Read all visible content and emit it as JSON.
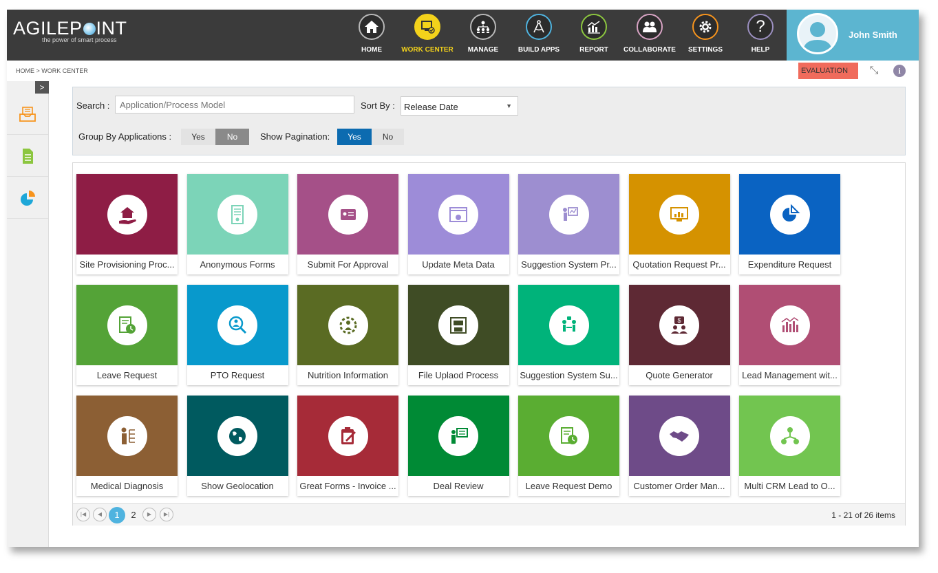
{
  "brand": {
    "name_left": "AGILEP",
    "name_right": "INT",
    "tagline": "the power of smart process"
  },
  "nav": [
    {
      "label": "HOME",
      "icon": "home-icon",
      "ring": "#b8b8b8"
    },
    {
      "label": "WORK CENTER",
      "icon": "work-center-icon",
      "ring": "#f3d21b"
    },
    {
      "label": "MANAGE",
      "icon": "manage-icon",
      "ring": "#b8b8b8"
    },
    {
      "label": "BUILD APPS",
      "icon": "build-apps-icon",
      "ring": "#4fb3df"
    },
    {
      "label": "REPORT",
      "icon": "report-icon",
      "ring": "#8cc63f"
    },
    {
      "label": "COLLABORATE",
      "icon": "collaborate-icon",
      "ring": "#d8a4c4"
    },
    {
      "label": "SETTINGS",
      "icon": "settings-icon",
      "ring": "#f7941d"
    },
    {
      "label": "HELP",
      "icon": "help-icon",
      "ring": "#9b8fc0"
    }
  ],
  "user": {
    "name": "John Smith"
  },
  "breadcrumb": "HOME > WORK CENTER",
  "badge": "EVALUATION",
  "filters": {
    "search_label": "Search :",
    "search_placeholder": "Application/Process Model",
    "sort_label": "Sort By :",
    "sort_value": "Release Date",
    "group_label": "Group By Applications :",
    "group_yes": "Yes",
    "group_no": "No",
    "group_selected": "No",
    "pagination_label": "Show Pagination:",
    "pagination_yes": "Yes",
    "pagination_no": "No",
    "pagination_selected": "Yes"
  },
  "apps": [
    {
      "label": "Site Provisioning Proc...",
      "color": "#8e1d45",
      "icon": "home-hand-icon"
    },
    {
      "label": "Anonymous Forms",
      "color": "#7cd4b8",
      "icon": "form-icon"
    },
    {
      "label": "Submit For Approval",
      "color": "#a55088",
      "icon": "id-card-icon"
    },
    {
      "label": "Update Meta Data",
      "color": "#9d8cd8",
      "icon": "browser-settings-icon"
    },
    {
      "label": "Suggestion System Pr...",
      "color": "#9d8ed0",
      "icon": "presentation-icon"
    },
    {
      "label": "Quotation Request Pr...",
      "color": "#d59200",
      "icon": "monitor-chart-icon"
    },
    {
      "label": "Expenditure Request",
      "color": "#0a63c2",
      "icon": "pie-chart-icon"
    },
    {
      "label": "Leave Request",
      "color": "#54a337",
      "icon": "document-clock-icon"
    },
    {
      "label": "PTO Request",
      "color": "#0899cc",
      "icon": "magnifier-person-icon"
    },
    {
      "label": "Nutrition Information",
      "color": "#5a6b23",
      "icon": "gear-person-icon"
    },
    {
      "label": "File Uplaod Process",
      "color": "#3f4c25",
      "icon": "atm-icon"
    },
    {
      "label": "Suggestion System Su...",
      "color": "#00b37a",
      "icon": "meeting-icon"
    },
    {
      "label": "Quote Generator",
      "color": "#5e2934",
      "icon": "dollar-people-icon"
    },
    {
      "label": "Lead Management wit...",
      "color": "#b04e74",
      "icon": "bar-trend-icon"
    },
    {
      "label": "Medical Diagnosis",
      "color": "#8c5f34",
      "icon": "person-flow-icon"
    },
    {
      "label": "Show Geolocation",
      "color": "#005a5f",
      "icon": "globe-icon"
    },
    {
      "label": "Great Forms - Invoice ...",
      "color": "#a62b38",
      "icon": "clipboard-pen-icon"
    },
    {
      "label": "Deal Review",
      "color": "#008a35",
      "icon": "presenter-board-icon"
    },
    {
      "label": "Leave Request Demo",
      "color": "#5aad32",
      "icon": "document-clock-icon"
    },
    {
      "label": "Customer Order Man...",
      "color": "#6e4b88",
      "icon": "handshake-icon"
    },
    {
      "label": "Multi CRM Lead to O...",
      "color": "#72c550",
      "icon": "network-people-icon"
    }
  ],
  "pager": {
    "page1": "1",
    "page2": "2",
    "info": "1 - 21 of 26 items"
  }
}
